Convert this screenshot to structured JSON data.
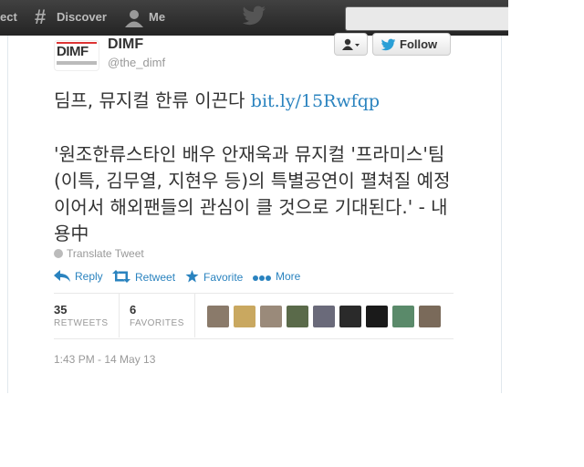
{
  "topbar": {
    "connect_label": "ect",
    "discover_label": "Discover",
    "me_label": "Me",
    "search_placeholder": ""
  },
  "tweet": {
    "avatar_text": "DIMF",
    "fullname": "DIMF",
    "username": "@the_dimf",
    "follow_label": "Follow",
    "headline": "딤프, 뮤지컬 한류 이끈다 ",
    "link": "bit.ly/15Rwfqp",
    "body": "'원조한류스타인 배우 안재욱과 뮤지컬 '프라미스'팀(이특, 김무열, 지현우 등)의 특별공연이 펼쳐질 예정이어서 해외팬들의 관심이 클 것으로 기대된다.' - 내용中",
    "translate_label": "Translate Tweet",
    "actions": {
      "reply": "Reply",
      "retweet": "Retweet",
      "favorite": "Favorite",
      "more": "More"
    },
    "stats": {
      "retweets_count": "35",
      "retweets_label": "RETWEETS",
      "favorites_count": "6",
      "favorites_label": "FAVORITES"
    },
    "timestamp": "1:43 PM - 14 May 13"
  },
  "colors": {
    "link": "#2a83bf",
    "topbar": "#2f2f2f",
    "favoriter_avatars": [
      "#8a7a6a",
      "#c9a860",
      "#9a8a7a",
      "#5a6a4a",
      "#6a6a7a",
      "#2a2a2a",
      "#1a1a1a",
      "#5a8a6a",
      "#7a6a5a"
    ]
  }
}
